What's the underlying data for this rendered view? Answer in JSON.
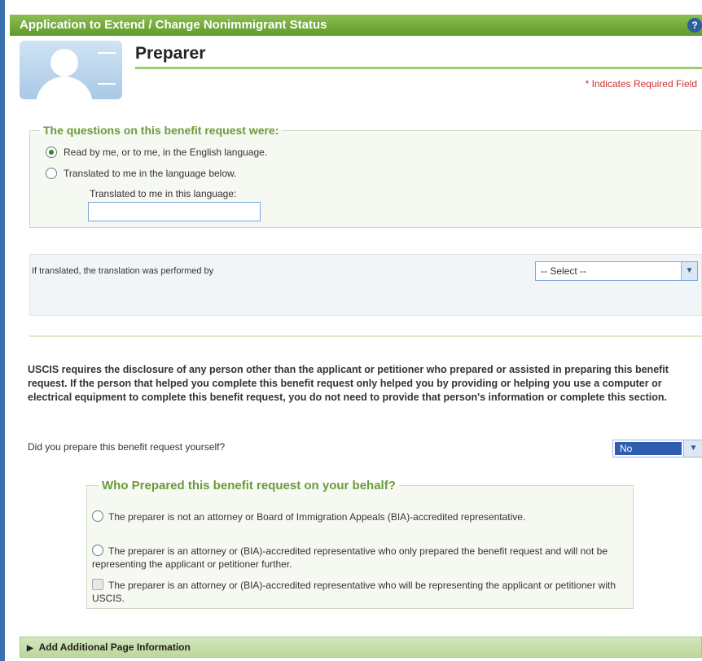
{
  "window": {
    "title": "Application to Extend / Change Nonimmigrant Status",
    "help_icon": "?"
  },
  "header": {
    "page_title": "Preparer",
    "required_note": "* Indicates Required Field"
  },
  "language_section": {
    "legend": "The questions on this benefit request were:",
    "options": [
      {
        "label": "Read by me, or to me, in the English language.",
        "selected": true
      },
      {
        "label": "Translated to me in the language below.",
        "selected": false
      }
    ],
    "language_label": "Translated to me in this language:",
    "language_value": ""
  },
  "translation_section": {
    "label": "If translated, the translation was performed by",
    "select_value": "-- Select --"
  },
  "disclosure_text": "USCIS requires the disclosure of any person other than the applicant or petitioner who prepared or assisted in preparing this benefit request. If the person that helped you complete this benefit request only helped you by providing or helping you use a computer or electrical equipment to complete this benefit request, you do not need to provide that person's information or complete this section.",
  "self_prepared": {
    "question": "Did you prepare this benefit request yourself?",
    "select_value": "No"
  },
  "who_prepared": {
    "legend": "Who Prepared this benefit request on your behalf?",
    "options": [
      "The preparer is not an attorney or Board of Immigration Appeals (BIA)-accredited representative.",
      "The preparer is an attorney or (BIA)-accredited representative who only prepared the benefit request and will not be representing the applicant or petitioner further.",
      "The preparer is an attorney or (BIA)-accredited representative who will be representing the applicant or petitioner with USCIS."
    ]
  },
  "footer": {
    "add_info_label": "Add Additional Page Information"
  }
}
